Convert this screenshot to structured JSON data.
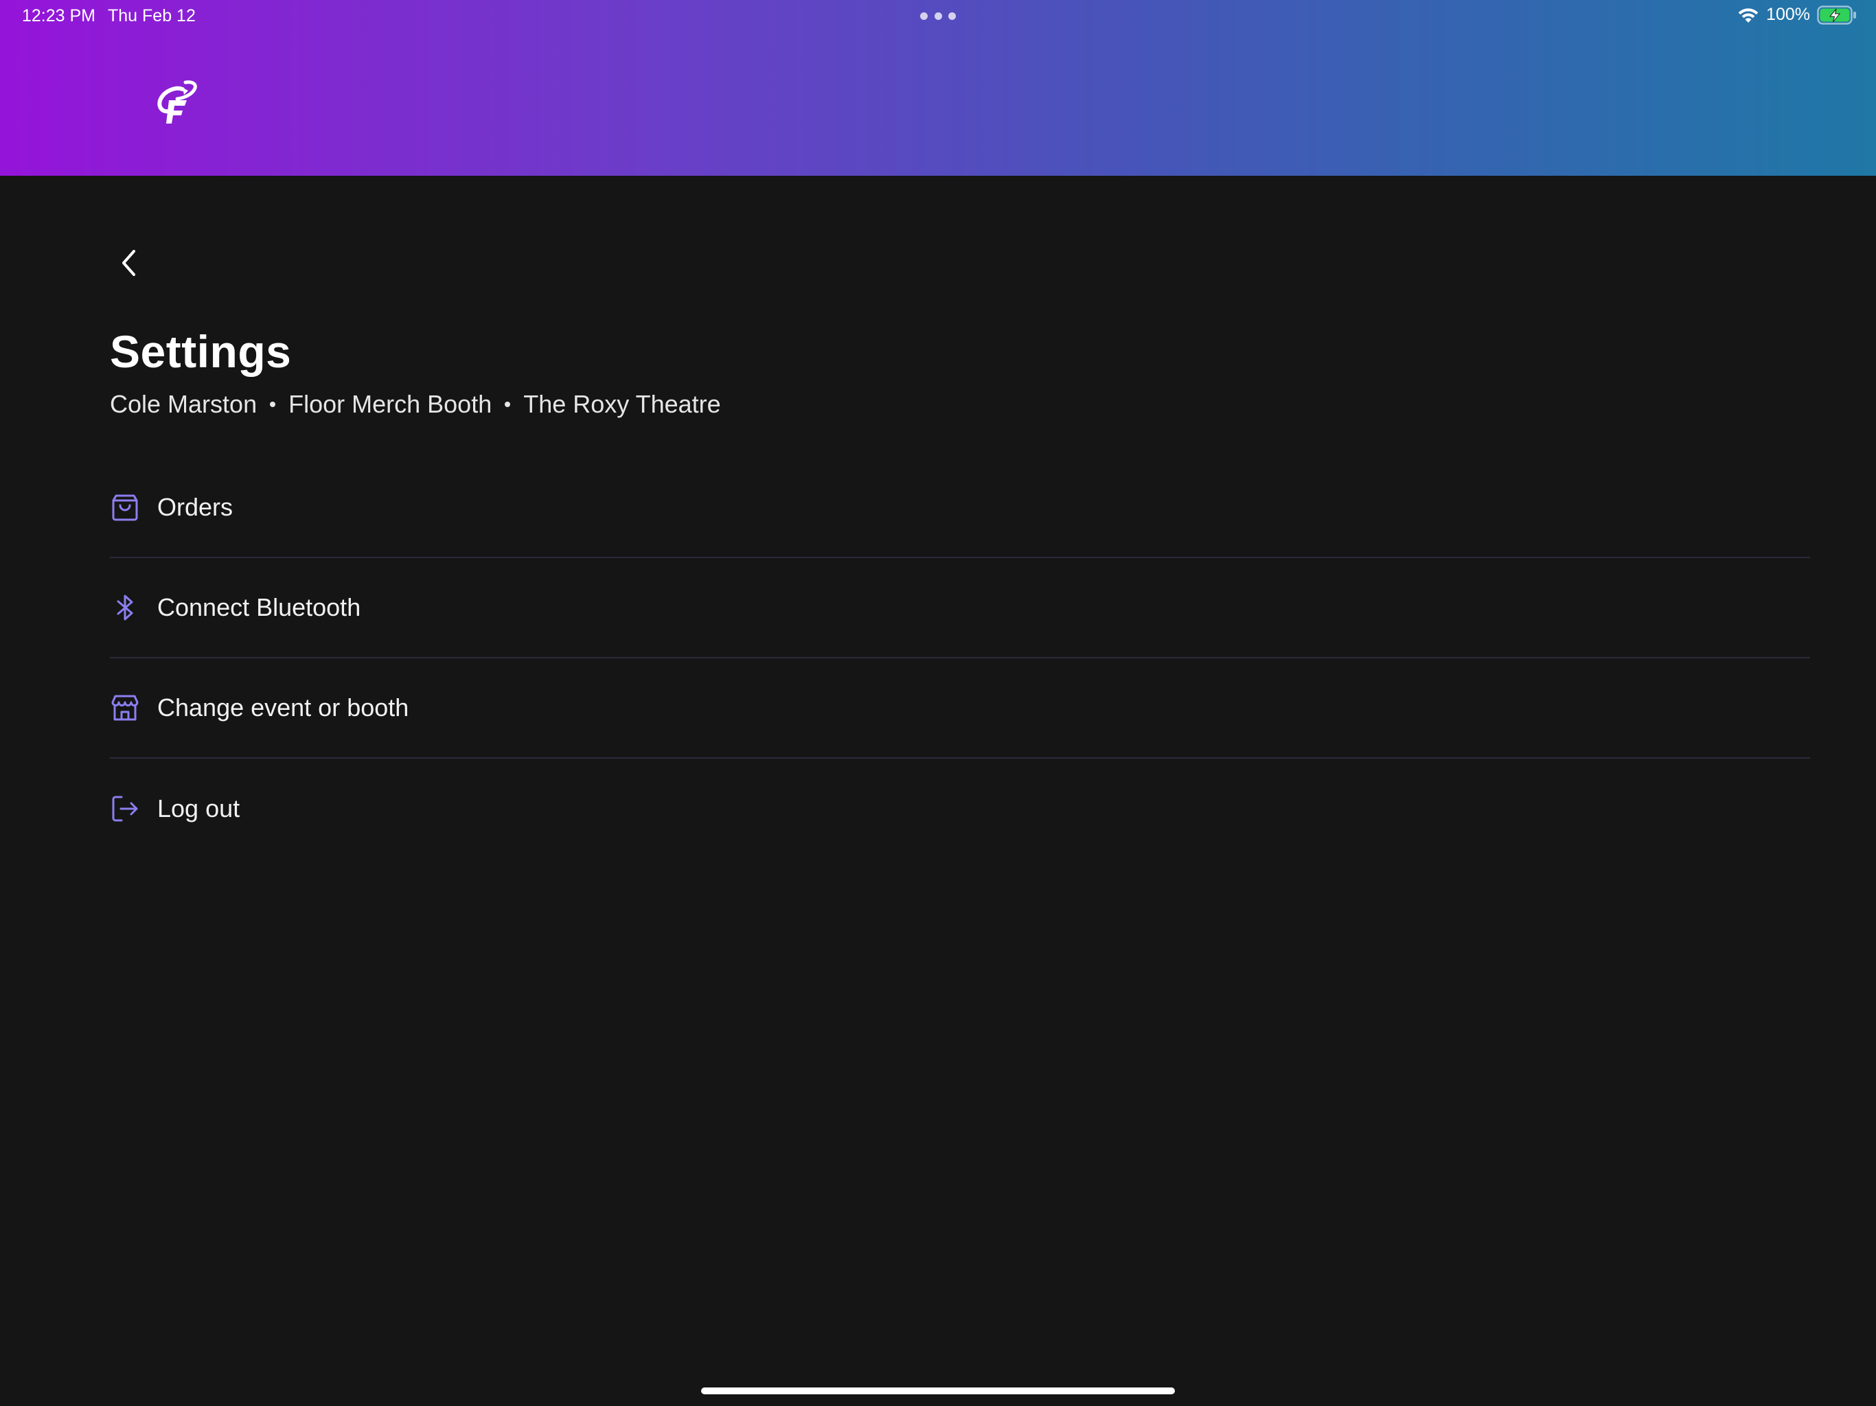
{
  "status_bar": {
    "time": "12:23 PM",
    "date": "Thu Feb 12",
    "battery_percent": "100%",
    "battery_level": 1.0,
    "battery_color": "#30d158",
    "charging": true
  },
  "header": {
    "gradient_colors": [
      "#9514d9",
      "#6a3ec8",
      "#4556b8",
      "#1f78a6"
    ],
    "logo_icon": "app-logo-icon"
  },
  "page": {
    "title": "Settings",
    "context": {
      "user": "Cole Marston",
      "booth": "Floor Merch Booth",
      "venue": "The Roxy Theatre"
    }
  },
  "menu": {
    "accent_color": "#8b7ff0",
    "items": [
      {
        "id": "orders",
        "label": "Orders",
        "icon": "shopping-bag-icon"
      },
      {
        "id": "bluetooth",
        "label": "Connect Bluetooth",
        "icon": "bluetooth-icon"
      },
      {
        "id": "change-event",
        "label": "Change event or booth",
        "icon": "storefront-icon"
      },
      {
        "id": "logout",
        "label": "Log out",
        "icon": "logout-icon"
      }
    ]
  }
}
